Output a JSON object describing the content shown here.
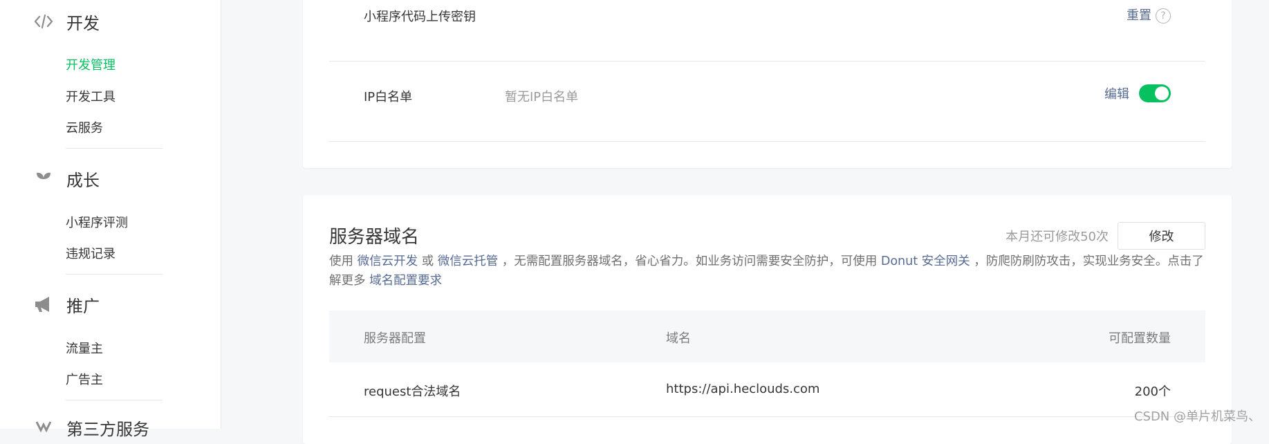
{
  "sidebar": {
    "sections": [
      {
        "title": "开发",
        "icon": "code-icon"
      },
      {
        "title": "成长",
        "icon": "sprout-icon"
      },
      {
        "title": "推广",
        "icon": "megaphone-icon"
      },
      {
        "title": "第三方服务",
        "icon": "third-party-icon"
      }
    ],
    "dev_items": [
      "开发管理",
      "开发工具",
      "云服务"
    ],
    "growth_items": [
      "小程序评测",
      "违规记录"
    ],
    "promo_items": [
      "流量主",
      "广告主"
    ]
  },
  "colors": {
    "accent": "#07c160",
    "link": "#576b95"
  },
  "settings": {
    "secret_label": "小程序代码上传密钥",
    "reset_label": "重置",
    "help_icon": "?",
    "ip_label": "IP白名单",
    "ip_value": "暂无IP白名单",
    "edit_label": "编辑",
    "ip_toggle_on": true
  },
  "server_domain": {
    "title": "服务器域名",
    "quota": "本月还可修改50次",
    "modify_label": "修改",
    "desc": {
      "p1": "使用 ",
      "link1": "微信云开发",
      "p2": " 或 ",
      "link2": "微信云托管",
      "p3": " ，无需配置服务器域名，省心省力。如业务访问需要安全防护，可使用 ",
      "link3": "Donut 安全网关",
      "p4": " ，防爬防刷防攻击，实现业务安全。点击了解更多 ",
      "link4": "域名配置要求"
    },
    "columns": [
      "服务器配置",
      "域名",
      "可配置数量"
    ],
    "rows": [
      {
        "config": "request合法域名",
        "domain": "https://api.heclouds.com",
        "count": "200个"
      }
    ]
  },
  "watermark": "CSDN @单片机菜鸟、"
}
